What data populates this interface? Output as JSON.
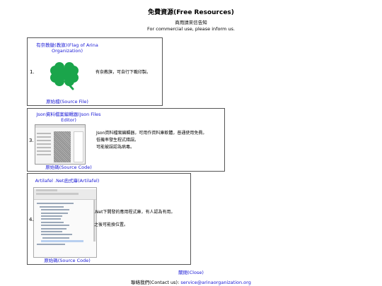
{
  "header": {
    "title": "免費資源(Free Resources)",
    "notice_zh": "商用請來信告知",
    "notice_en": "For commercial use, please inform us."
  },
  "resources": [
    {
      "number": "1.",
      "title": "有奈教徽(教旗)(Flag of Arina Organization)",
      "description": "有奈教旗，可自行下載印製。",
      "source_link": "原始檔(Source File)",
      "thumb_icon": "four-leaf-clover",
      "accent_color": "#1aa54b"
    },
    {
      "number": "3.",
      "title": "Json資料檔案編輯器(Json Files Editor)",
      "description_lines": [
        "Json資料檔案編輯器，可用作資料庫軟體，普通使用免費。",
        "低機率發生程式錯誤。",
        "可能被誤認為病毒。"
      ],
      "source_link": "原始碼(Source Code)"
    },
    {
      "number": "4.",
      "title": "Artilafel .Net函式庫(Artilafel)",
      "description_lines": [
        ".Net下開發的應用程式庫，有人認為有用。",
        "之後可能換位置。"
      ],
      "source_link": "原始碼(Source Code)"
    }
  ],
  "footer": {
    "close_link": "關閉(Close)",
    "contact_label": "聯絡我們(Contact us): ",
    "contact_email": "service@arinaorganization.org"
  },
  "colors": {
    "link": "#1a1ad6",
    "border": "#555555"
  }
}
